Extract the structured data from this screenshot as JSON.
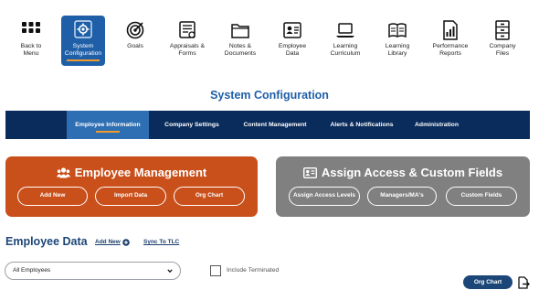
{
  "topnav": {
    "items": [
      {
        "label1": "Back to",
        "label2": "Menu",
        "icon": "grid-icon"
      },
      {
        "label1": "System",
        "label2": "Configuration",
        "icon": "gear-icon",
        "active": true
      },
      {
        "label1": "Goals",
        "label2": "",
        "icon": "target-icon"
      },
      {
        "label1": "Appraisals &",
        "label2": "Forms",
        "icon": "appraisal-icon"
      },
      {
        "label1": "Notes &",
        "label2": "Documents",
        "icon": "folder-icon"
      },
      {
        "label1": "Employee",
        "label2": "Data",
        "icon": "id-card-icon"
      },
      {
        "label1": "Learning",
        "label2": "Curriculum",
        "icon": "laptop-icon"
      },
      {
        "label1": "Learning",
        "label2": "Library",
        "icon": "book-icon"
      },
      {
        "label1": "Performance",
        "label2": "Reports",
        "icon": "report-icon"
      },
      {
        "label1": "Company",
        "label2": "Files",
        "icon": "file-cabinet-icon"
      }
    ]
  },
  "page": {
    "title": "System Configuration"
  },
  "tabs": [
    {
      "label": "Employee Information",
      "active": true
    },
    {
      "label": "Company Settings"
    },
    {
      "label": "Content Management"
    },
    {
      "label": "Alerts & Notifications"
    },
    {
      "label": "Administration"
    }
  ],
  "cards": {
    "employee_management": {
      "title": "Employee Management",
      "icon": "users-icon",
      "buttons": [
        "Add New",
        "Import Data",
        "Org Chart"
      ]
    },
    "assign_access": {
      "title": "Assign Access & Custom Fields",
      "icon": "contact-card-icon",
      "buttons": [
        "Assign Access Levels",
        "Managers/MA's",
        "Custom Fields"
      ]
    }
  },
  "employee_data": {
    "title": "Employee Data",
    "add_new": "Add New",
    "sync": "Sync To TLC",
    "filter_value": "All Employees",
    "include_terminated": "Include Terminated",
    "org_chart": "Org Chart"
  },
  "colors": {
    "primary_blue": "#1f5fa8",
    "navy": "#0a2c5c",
    "orange_card": "#c94f1b",
    "gray_card": "#808080",
    "accent_orange": "#f39a2b"
  }
}
